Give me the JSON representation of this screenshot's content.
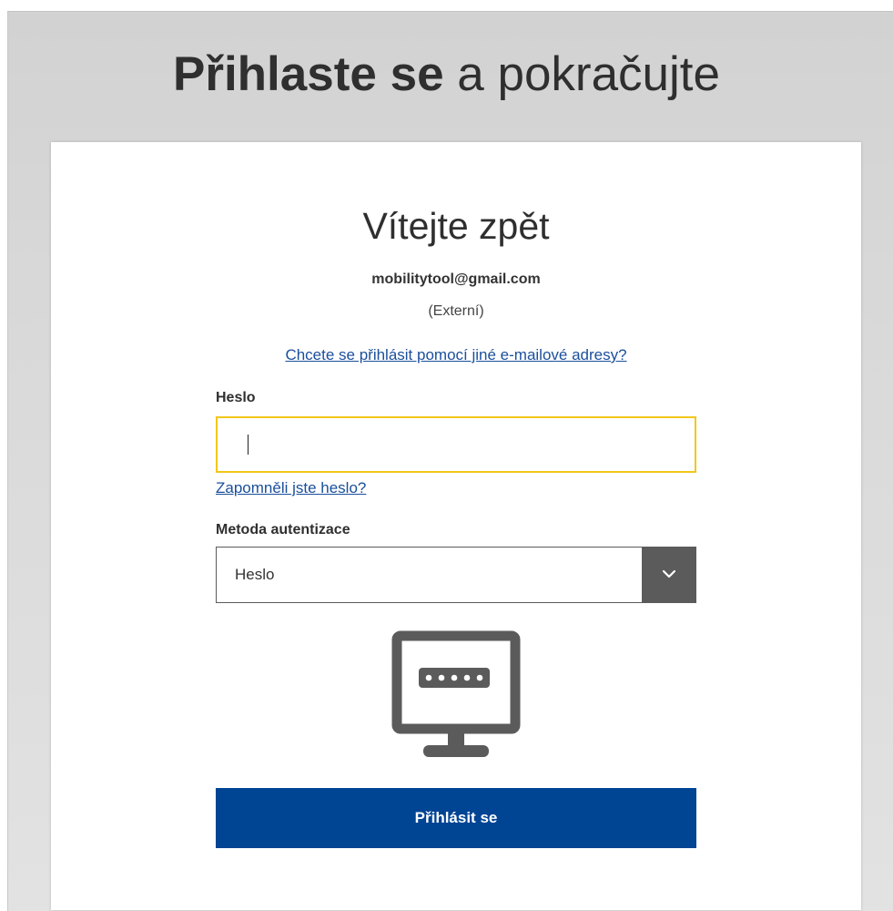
{
  "page": {
    "heading_bold": "Přihlaste se",
    "heading_regular": "a pokračujte"
  },
  "card": {
    "welcome_title": "Vítejte zpět",
    "email": "mobilitytool@gmail.com",
    "account_type": "(Externí)",
    "other_email_link": "Chcete se přihlásit pomocí jiné e-mailové adresy?",
    "password_label": "Heslo",
    "password_value": "",
    "forgot_password_link": "Zapomněli jste heslo?",
    "auth_method_label": "Metoda autentizace",
    "auth_method_selected": "Heslo",
    "submit_label": "Přihlásit se"
  },
  "icons": {
    "dropdown": "chevron-down-icon",
    "auth_method_illustration": "monitor-password-icon"
  },
  "colors": {
    "primary_button": "#004494",
    "link": "#1a4f9c",
    "input_focus_border": "#f2c71a",
    "dropdown_button": "#5b5b5b",
    "icon": "#5b5b5b"
  }
}
